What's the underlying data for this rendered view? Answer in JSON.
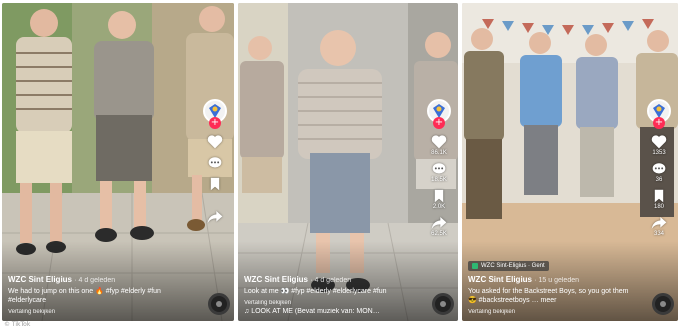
{
  "colors": {
    "like": "#fe2c55",
    "location_pin": "#2eb872"
  },
  "icons": [
    "heart-icon",
    "comment-icon",
    "bookmark-icon",
    "share-icon",
    "plus-icon",
    "music-disc-icon",
    "location-pin-icon"
  ],
  "watermark": "© TikTok",
  "cards": [
    {
      "follow": "+",
      "likes": "",
      "comments": "",
      "saves": "",
      "shares": "",
      "author": "WZC Sint Eligius",
      "ago": "· 4 d geleden",
      "description": "We had to jump on this one 🔥 #fyp #elderly #fun #elderlycare",
      "sound": "",
      "translate": "Vertaling bekijken",
      "location": ""
    },
    {
      "follow": "+",
      "likes": "86.1K",
      "comments": "18.5K",
      "saves": "2.0K",
      "shares": "62.5K",
      "author": "WZC Sint Eligius",
      "ago": "· 4 d geleden",
      "description": "Look at me 👀 #fyp #elderly #elderlycare #fun",
      "sound": "♫ LOOK AT ME (Bevat muziek van: MON…",
      "translate": "Vertaling bekijken",
      "location": ""
    },
    {
      "follow": "+",
      "likes": "1353",
      "comments": "36",
      "saves": "180",
      "shares": "334",
      "author": "WZC Sint Eligius",
      "ago": "· 15 u geleden",
      "description": "You asked for the Backstreet Boys, so you got them 😎 #backstreetboys … meer",
      "sound": "",
      "translate": "Vertaling bekijken",
      "location": "WZC Sint-Eligius · Gent"
    }
  ]
}
